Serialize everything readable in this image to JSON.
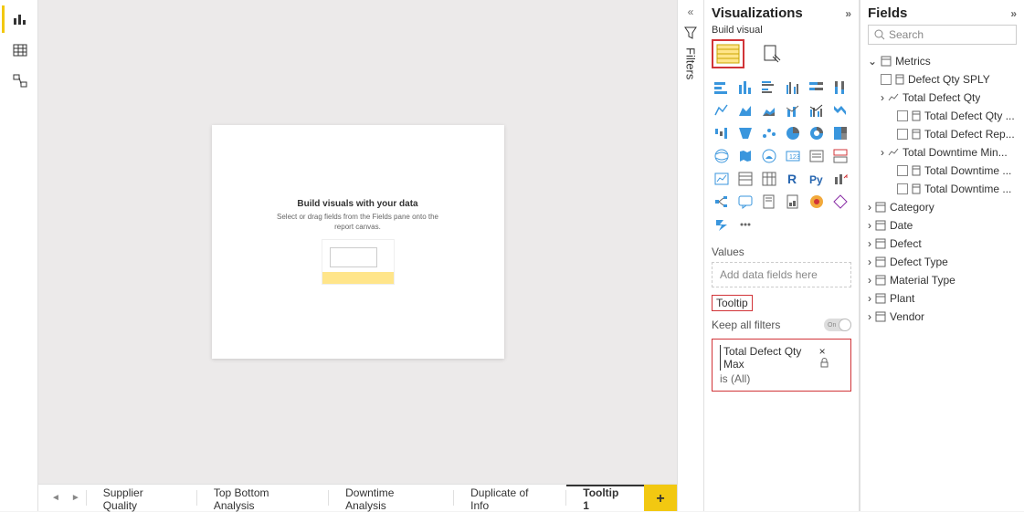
{
  "panes": {
    "visualizations_title": "Visualizations",
    "fields_title": "Fields",
    "filters_title": "Filters",
    "build_visual": "Build visual"
  },
  "canvas": {
    "placeholder_title": "Build visuals with your data",
    "placeholder_sub": "Select or drag fields from the Fields pane onto the report canvas."
  },
  "tabs": {
    "items": [
      "Supplier Quality",
      "Top Bottom Analysis",
      "Downtime Analysis",
      "Duplicate of Info",
      "Tooltip 1"
    ],
    "active_index": 4,
    "add_label": "+"
  },
  "viz": {
    "values_label": "Values",
    "values_placeholder": "Add data fields here",
    "tooltip_label": "Tooltip",
    "keep_filters_label": "Keep all filters",
    "keep_filters_state": "On",
    "tooltip_field": "Total Defect Qty Max",
    "tooltip_filter": "is (All)"
  },
  "fields": {
    "search_placeholder": "Search",
    "metrics_label": "Metrics",
    "metrics": {
      "defect_qty_sply": "Defect Qty SPLY",
      "total_defect_qty": "Total Defect Qty",
      "total_defect_qty_child1": "Total Defect Qty ...",
      "total_defect_qty_child2": "Total Defect Rep...",
      "total_downtime_min": "Total Downtime Min...",
      "total_downtime_child1": "Total Downtime ...",
      "total_downtime_child2": "Total Downtime ..."
    },
    "tables": [
      "Category",
      "Date",
      "Defect",
      "Defect Type",
      "Material Type",
      "Plant",
      "Vendor"
    ]
  }
}
